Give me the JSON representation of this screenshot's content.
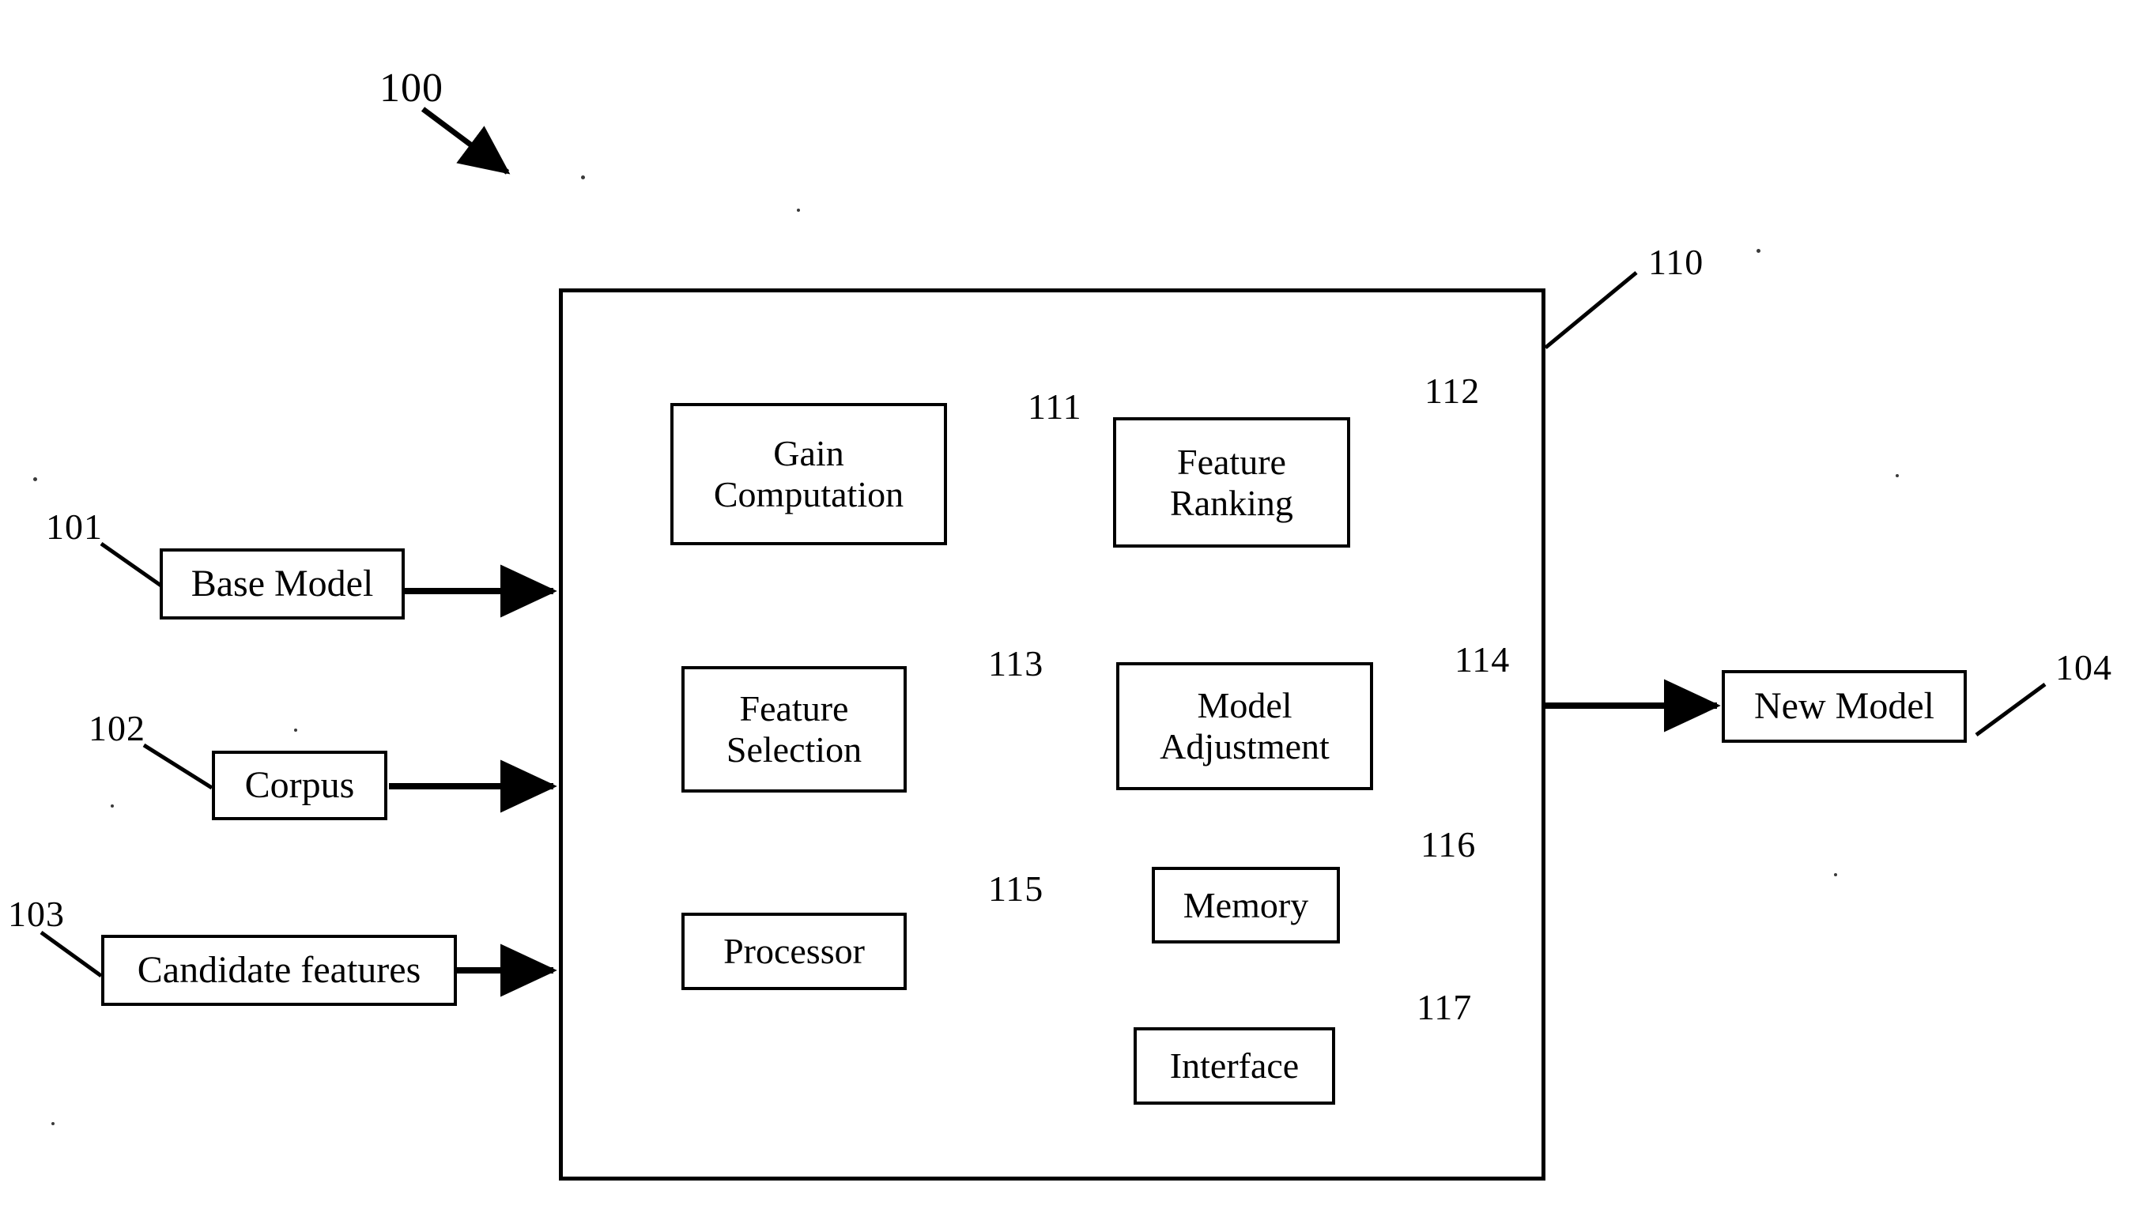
{
  "figure": {
    "type": "patent-block-diagram",
    "overall_reference": "100"
  },
  "system_container": {
    "reference": "110"
  },
  "inputs": [
    {
      "label": "Base Model",
      "reference": "101"
    },
    {
      "label": "Corpus",
      "reference": "102"
    },
    {
      "label": "Candidate features",
      "reference": "103"
    }
  ],
  "outputs": [
    {
      "label": "New Model",
      "reference": "104"
    }
  ],
  "modules": [
    {
      "label": "Gain\nComputation",
      "reference": "111"
    },
    {
      "label": "Feature\nRanking",
      "reference": "112"
    },
    {
      "label": "Feature\nSelection",
      "reference": "113"
    },
    {
      "label": "Model\nAdjustment",
      "reference": "114"
    },
    {
      "label": "Processor",
      "reference": "115"
    },
    {
      "label": "Memory",
      "reference": "116"
    },
    {
      "label": "Interface",
      "reference": "117"
    }
  ],
  "colors": {
    "ink": "#000000",
    "paper": "#ffffff"
  }
}
